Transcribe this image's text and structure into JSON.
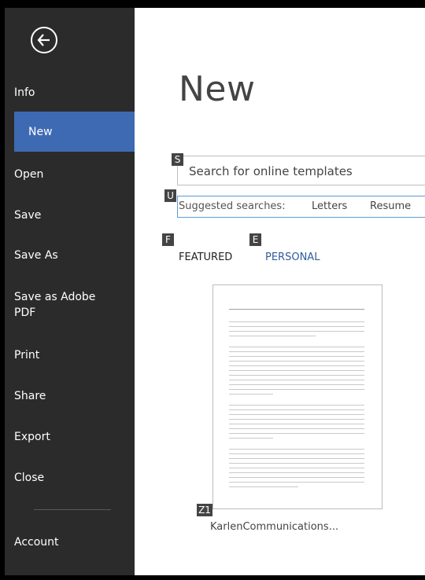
{
  "nav": {
    "back_label": "Back",
    "items": [
      {
        "label": "Info",
        "active": false
      },
      {
        "label": "New",
        "active": true
      },
      {
        "label": "Open",
        "active": false
      },
      {
        "label": "Save",
        "active": false
      },
      {
        "label": "Save As",
        "active": false
      },
      {
        "label": "Save as Adobe",
        "label2": "PDF",
        "active": false
      },
      {
        "label": "Print",
        "active": false
      },
      {
        "label": "Share",
        "active": false
      },
      {
        "label": "Export",
        "active": false
      },
      {
        "label": "Close",
        "active": false
      },
      {
        "label": "Account",
        "active": false
      }
    ]
  },
  "main": {
    "title": "New",
    "search": {
      "placeholder": "Search for online templates",
      "key": "S"
    },
    "suggested": {
      "label": "Suggested searches:",
      "key": "U",
      "links": [
        "Letters",
        "Resume"
      ]
    },
    "tabs": [
      {
        "label": "FEATURED",
        "key": "F"
      },
      {
        "label": "PERSONAL",
        "key": "E"
      }
    ],
    "template": {
      "name": "KarlenCommunications...",
      "key": "Z1"
    }
  },
  "colors": {
    "sidebar": "#2b2b2b",
    "active": "#3d6ab3",
    "link": "#2e5c9a"
  }
}
